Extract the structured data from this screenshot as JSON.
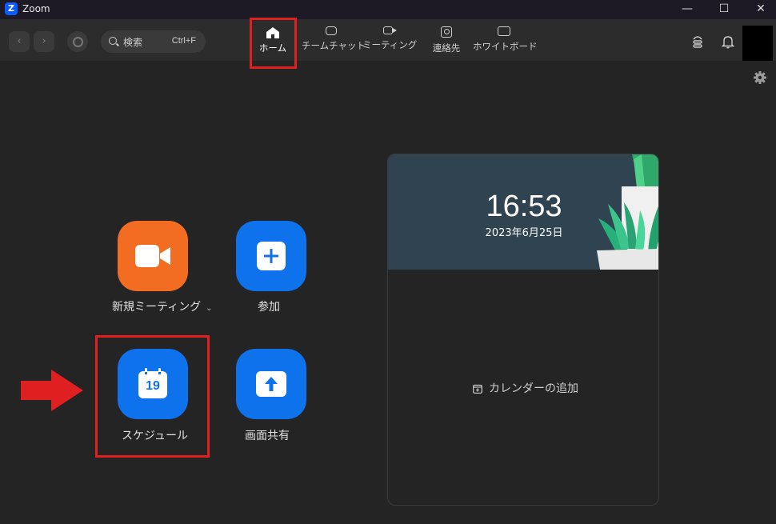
{
  "window": {
    "title": "Zoom",
    "logo_letter": "Z",
    "minimize": "—",
    "maximize": "☐",
    "close": "✕"
  },
  "toolbar": {
    "back": "‹",
    "forward": "›",
    "search_placeholder": "検索",
    "search_shortcut": "Ctrl+F",
    "tabs": [
      {
        "label": "ホーム",
        "icon": "home-icon",
        "active": true
      },
      {
        "label": "チームチャット",
        "icon": "chat-icon",
        "active": false
      },
      {
        "label": "ミーティング",
        "icon": "video-icon",
        "active": false
      },
      {
        "label": "連絡先",
        "icon": "contacts-icon",
        "active": false
      },
      {
        "label": "ホワイトボード",
        "icon": "whiteboard-icon",
        "active": false
      }
    ]
  },
  "actions": {
    "new_meeting": "新規ミーティング",
    "join": "参加",
    "schedule": "スケジュール",
    "schedule_day": "19",
    "share_screen": "画面共有"
  },
  "calendar_card": {
    "time": "16:53",
    "date": "2023年6月25日",
    "add_calendar": "カレンダーの追加"
  },
  "colors": {
    "accent_blue": "#0e72ed",
    "accent_orange": "#f26d21",
    "highlight_red": "#e02020"
  }
}
